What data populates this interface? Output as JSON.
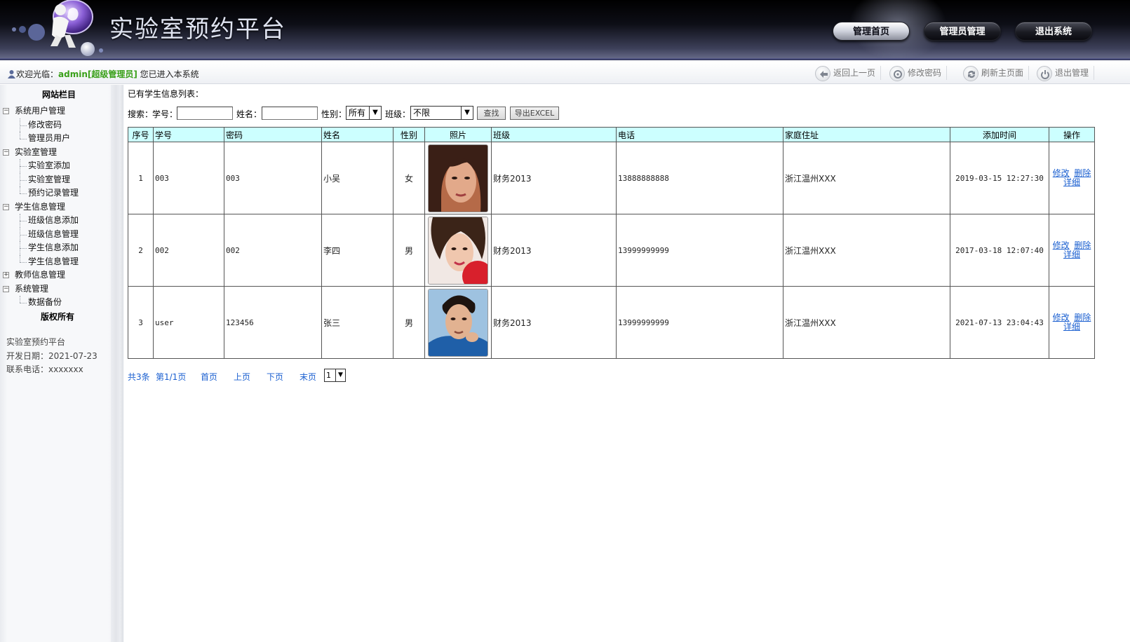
{
  "app": {
    "title": "实验室预约平台"
  },
  "nav": {
    "items": [
      {
        "label": "管理首页"
      },
      {
        "label": "管理员管理"
      },
      {
        "label": "退出系统"
      }
    ]
  },
  "topbar": {
    "welcome_prefix": "欢迎光临：",
    "user": "admin[超级管理员]",
    "welcome_suffix": " 您已进入本系统",
    "tools": [
      {
        "label": "返回上一页",
        "icon": "back-arrow-icon"
      },
      {
        "label": "修改密码",
        "icon": "refresh-key-icon"
      },
      {
        "label": "刷新主页面",
        "icon": "refresh-icon"
      },
      {
        "label": "退出管理",
        "icon": "power-icon"
      }
    ]
  },
  "sidebar": {
    "title": "网站栏目",
    "groups": [
      {
        "label": "系统用户管理",
        "expanded": true,
        "items": [
          "修改密码",
          "管理员用户"
        ]
      },
      {
        "label": "实验室管理",
        "expanded": true,
        "items": [
          "实验室添加",
          "实验室管理",
          "预约记录管理"
        ]
      },
      {
        "label": "学生信息管理",
        "expanded": true,
        "items": [
          "班级信息添加",
          "班级信息管理",
          "学生信息添加",
          "学生信息管理"
        ]
      },
      {
        "label": "教师信息管理",
        "expanded": false,
        "items": []
      },
      {
        "label": "系统管理",
        "expanded": true,
        "items": [
          "数据备份"
        ]
      }
    ],
    "copyright": "版权所有",
    "info": [
      "实验室预约平台",
      "开发日期：2021-07-23",
      "联系电话：xxxxxxx"
    ]
  },
  "main": {
    "list_title": "已有学生信息列表：",
    "search": {
      "label": "搜索：",
      "student_no_label": "学号：",
      "student_no_value": "",
      "name_label": "姓名：",
      "name_value": "",
      "gender_label": "性别：",
      "gender_value": "所有",
      "class_label": "班级：",
      "class_value": "不限",
      "search_button": "查找",
      "export_button": "导出EXCEL"
    },
    "table": {
      "headers": [
        "序号",
        "学号",
        "密码",
        "姓名",
        "性别",
        "照片",
        "班级",
        "电话",
        "家庭住址",
        "添加时间",
        "操作"
      ],
      "rows": [
        {
          "index": "1",
          "student_no": "003",
          "password": "003",
          "name": "小吴",
          "gender": "女",
          "class": "财务2013",
          "phone": "13888888888",
          "address": "浙江温州XXX",
          "added": "2019-03-15 12:27:30"
        },
        {
          "index": "2",
          "student_no": "002",
          "password": "002",
          "name": "李四",
          "gender": "男",
          "class": "财务2013",
          "phone": "13999999999",
          "address": "浙江温州XXX",
          "added": "2017-03-18 12:07:40"
        },
        {
          "index": "3",
          "student_no": "user",
          "password": "123456",
          "name": "张三",
          "gender": "男",
          "class": "财务2013",
          "phone": "13999999999",
          "address": "浙江温州XXX",
          "added": "2021-07-13 23:04:43"
        }
      ],
      "ops": {
        "edit": "修改",
        "delete": "删除",
        "detail": "详细"
      }
    },
    "pager": {
      "total": "共3条",
      "page": "第1/1页",
      "first": "首页",
      "prev": "上页",
      "next": "下页",
      "last": "末页",
      "select_value": "1"
    }
  },
  "colors": {
    "table_header": "#ccffff",
    "user_green": "#3aa01a",
    "link_blue": "#1a5fd0"
  }
}
